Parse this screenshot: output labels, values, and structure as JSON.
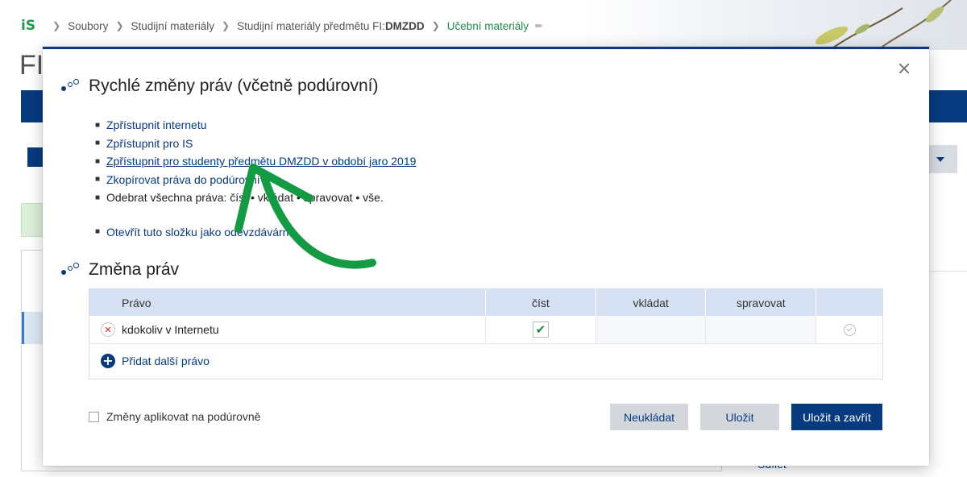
{
  "breadcrumb": {
    "logo": "iS",
    "items": [
      "Soubory",
      "Studijní materiály",
      "Studijní materiály předmětu FI:",
      "Učební materiály"
    ],
    "item3_bold": "DMZDD"
  },
  "background": {
    "page_title_fragment": "FI",
    "side_text": "Sdílet"
  },
  "modal": {
    "section1_title": "Rychlé změny práv (včetně podúrovní)",
    "links": [
      "Zpřístupnit internetu",
      "Zpřístupnit pro IS",
      "Zpřístupnit pro studenty předmětu DMZDD v období jaro 2019",
      "Zkopírovat práva do podúrovní",
      "Odebrat všechna práva: číst • vkládat • spravovat • vše.",
      "Otevřít tuto složku jako odevzdávárnu"
    ],
    "section2_title": "Změna práv",
    "table": {
      "headers": [
        "Právo",
        "číst",
        "vkládat",
        "spravovat",
        ""
      ],
      "rows": [
        {
          "name": "kdokoliv v Internetu",
          "cist": true,
          "vkladat": false,
          "spravovat": false
        }
      ],
      "add_label": "Přidat další právo"
    },
    "apply_sublevels_label": "Změny aplikovat na podúrovně",
    "buttons": {
      "discard": "Neukládat",
      "save": "Uložit",
      "save_close": "Uložit a zavřít"
    }
  },
  "colors": {
    "primary": "#083a80",
    "accent_green": "#1f9b50",
    "annotation_arrow": "#139a43",
    "table_header": "#d6e2f3"
  }
}
